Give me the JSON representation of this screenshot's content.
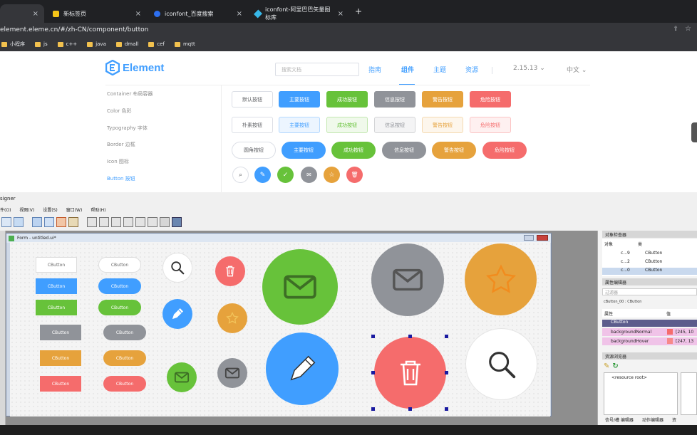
{
  "browser": {
    "tabs": [
      {
        "label": "",
        "icon": "page-icon"
      },
      {
        "label": "新标签页",
        "icon": "newtab-icon"
      },
      {
        "label": "iconfont_百度搜索",
        "icon": "baidu-icon"
      },
      {
        "label": "iconfont-阿里巴巴矢量图标库",
        "icon": "iconfont-icon"
      }
    ],
    "close": "×",
    "new_tab": "+",
    "url": "element.eleme.cn/#/zh-CN/component/button",
    "bookmarks": [
      "小程序",
      "js",
      "c++",
      "java",
      "dmall",
      "cef",
      "mqtt"
    ]
  },
  "website": {
    "logo_text": "Element",
    "search_placeholder": "搜索文档",
    "nav": [
      "指南",
      "组件",
      "主题",
      "资源"
    ],
    "version": "2.15.13",
    "lang": "中文",
    "sidebar": [
      "Container 布局容器",
      "Color 色彩",
      "Typography 字体",
      "Border 边框",
      "Icon 图标",
      "Button 按钮"
    ],
    "rows": [
      [
        "默认按钮",
        "主要按钮",
        "成功按钮",
        "信息按钮",
        "警告按钮",
        "危险按钮"
      ],
      [
        "朴素按钮",
        "主要按钮",
        "成功按钮",
        "信息按钮",
        "警告按钮",
        "危险按钮"
      ],
      [
        "圆角按钮",
        "主要按钮",
        "成功按钮",
        "信息按钮",
        "警告按钮",
        "危险按钮"
      ]
    ],
    "colors": {
      "primary": "#409eff",
      "success": "#67c23a",
      "info": "#909399",
      "warning": "#e6a23c",
      "danger": "#f56c6c"
    }
  },
  "designer": {
    "title": "signer",
    "menu": [
      "件(O)",
      "视图(V)",
      "设置(S)",
      "窗口(W)",
      "帮助(H)"
    ],
    "form_title": "Form - untitled.ui*",
    "button_text": "CButton",
    "object_inspector": {
      "title": "对象检查器",
      "col1": "对象",
      "col2": "类",
      "rows": [
        {
          "name": "c...9",
          "cls": "CButton"
        },
        {
          "name": "c...2",
          "cls": "CButton"
        },
        {
          "name": "c...0",
          "cls": "CButton"
        }
      ]
    },
    "property_editor": {
      "title": "属性编辑器",
      "filter_placeholder": "过滤器",
      "object_line": "cButton_00 : CButton",
      "col1": "属性",
      "col2": "值",
      "section": "CButton",
      "props": [
        {
          "name": "backgroundNormal",
          "value": "[245, 10"
        },
        {
          "name": "backgroundHover",
          "value": "[247, 13"
        }
      ]
    },
    "resource_browser": {
      "title": "资源浏览器",
      "root": "<resource root>"
    },
    "bottom_tabs": [
      "信号/槽 编辑器",
      "动作编辑器",
      "资"
    ]
  }
}
